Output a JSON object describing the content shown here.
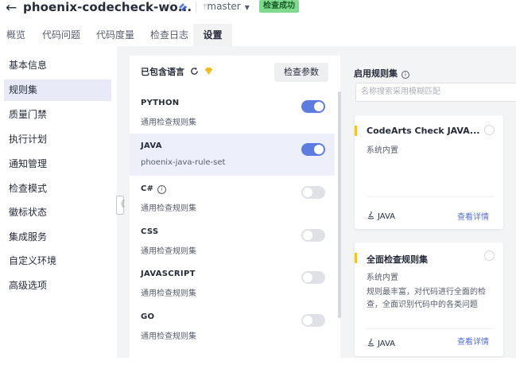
{
  "header": {
    "back_symbol": "←",
    "project_title": "phoenix-codecheck-wo...",
    "branch": "master",
    "branch_caret": "▼",
    "status_badge": "检查成功",
    "colors": {
      "badge_bg": "#7fd98e",
      "accent": "#5e7ce0"
    }
  },
  "tabs": [
    {
      "label": "概览"
    },
    {
      "label": "代码问题"
    },
    {
      "label": "代码度量"
    },
    {
      "label": "检查日志"
    },
    {
      "label": "设置"
    }
  ],
  "sidebar": {
    "items": [
      {
        "label": "基本信息"
      },
      {
        "label": "规则集"
      },
      {
        "label": "质量门禁"
      },
      {
        "label": "执行计划"
      },
      {
        "label": "通知管理"
      },
      {
        "label": "检查模式"
      },
      {
        "label": "徽标状态"
      },
      {
        "label": "集成服务"
      },
      {
        "label": "自定义环境"
      },
      {
        "label": "高级选项"
      }
    ],
    "collapse_symbol": "《"
  },
  "languages": {
    "header": "已包含语言",
    "param_button": "检查参数",
    "items": [
      {
        "name": "PYTHON",
        "ruleset": "通用检查规则集",
        "enabled": true
      },
      {
        "name": "JAVA",
        "ruleset": "phoenix-java-rule-set",
        "enabled": true
      },
      {
        "name": "C#",
        "ruleset": "通用检查规则集",
        "enabled": false
      },
      {
        "name": "CSS",
        "ruleset": "通用检查规则集",
        "enabled": false
      },
      {
        "name": "JAVASCRIPT",
        "ruleset": "通用检查规则集",
        "enabled": false
      },
      {
        "name": "GO",
        "ruleset": "通用检查规则集",
        "enabled": false
      }
    ]
  },
  "rulesets": {
    "header": "启用规则集",
    "search_placeholder": "名称搜索采用模糊匹配",
    "cards": [
      {
        "title": "CodeArts Check JAVA...",
        "source": "系统内置",
        "description": "",
        "language": "JAVA",
        "detail_link": "查看详情"
      },
      {
        "title": "全面检查规则集",
        "source": "系统内置",
        "description": "规则最丰富，对代码进行全面的检查，全面识别代码中的各类问题",
        "language": "JAVA",
        "detail_link": "查看详情"
      }
    ]
  }
}
